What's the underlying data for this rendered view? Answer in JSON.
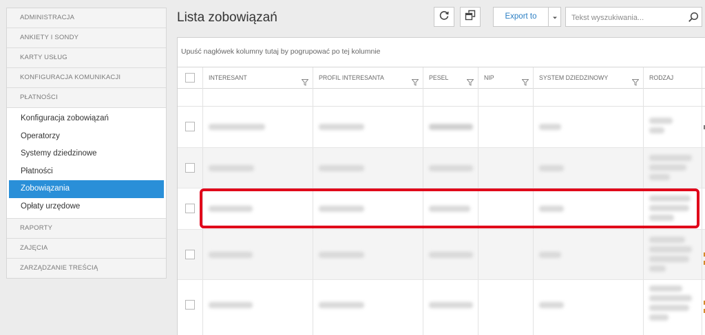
{
  "sidebar": {
    "sections_top": [
      {
        "label": "ADMINISTRACJA"
      },
      {
        "label": "ANKIETY I SONDY"
      },
      {
        "label": "KARTY USŁUG"
      },
      {
        "label": "KONFIGURACJA KOMUNIKACJI"
      },
      {
        "label": "PŁATNOŚCI"
      }
    ],
    "payments_items": [
      {
        "label": "Konfiguracja zobowiązań",
        "active": false
      },
      {
        "label": "Operatorzy",
        "active": false
      },
      {
        "label": "Systemy dziedzinowe",
        "active": false
      },
      {
        "label": "Płatności",
        "active": false
      },
      {
        "label": "Zobowiązania",
        "active": true
      },
      {
        "label": "Opłaty urzędowe",
        "active": false
      }
    ],
    "sections_bottom": [
      {
        "label": "RAPORTY"
      },
      {
        "label": "ZAJĘCIA"
      },
      {
        "label": "ZARZĄDZANIE TREŚCIĄ"
      }
    ]
  },
  "header": {
    "title": "Lista zobowiązań",
    "export_label": "Export to",
    "search_placeholder": "Tekst wyszukiwania..."
  },
  "grid": {
    "group_hint": "Upuść nagłówek kolumny tutaj by pogrupować po tej kolumnie",
    "columns": [
      {
        "label": "INTERESANT"
      },
      {
        "label": "PROFIL INTERESANTA"
      },
      {
        "label": "PESEL"
      },
      {
        "label": "NIP"
      },
      {
        "label": "SYSTEM DZIEDZINOWY"
      },
      {
        "label": "RODZAJ"
      }
    ]
  },
  "colors": {
    "accent": "#2a8fd8",
    "highlight": "#e0001a",
    "link": "#2a7ec3"
  },
  "icons": [
    "refresh-icon",
    "window-restore-icon",
    "caret-down-icon",
    "search-icon",
    "filter-icon"
  ]
}
